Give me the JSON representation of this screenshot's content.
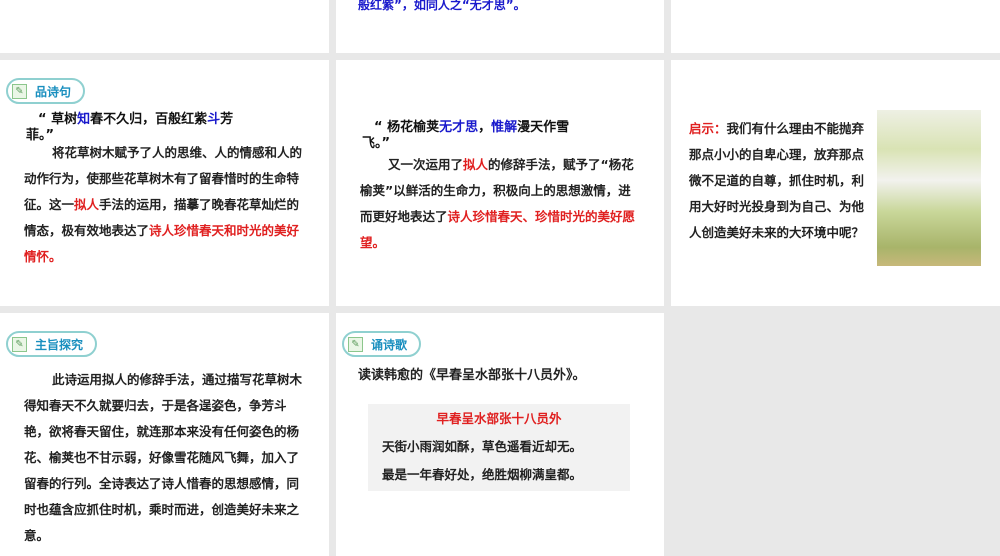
{
  "slides": {
    "s2": {
      "text": "般红紫”，如同人之“无才思”。"
    },
    "s4": {
      "badge": "品诗句",
      "quote_a": "“ 草树",
      "quote_b": "知",
      "quote_c": "春不久归，百般红紫",
      "quote_d": "斗",
      "quote_e": "芳",
      "quote_f": "菲。”",
      "p1": "将花草树木赋予了人的思维、人的情感和人的动作行为，使那些花草树木有了留春惜时的生命特征。这一",
      "p_red1": "拟人",
      "p2": "手法的运用，描摹了晚春花草灿烂的情态，极有效地表达了",
      "p_red2": "诗人珍惜春天和时光的美好情怀。"
    },
    "s5": {
      "quote_a": "“ 杨花榆荚",
      "quote_b": "无才思",
      "quote_c": "，",
      "quote_d": "惟解",
      "quote_e": "漫天作雪",
      "quote_f": "飞。”",
      "p1": "又一次运用了",
      "p_red1": "拟人",
      "p2": "的修辞手法，赋予了“杨花榆荚”以鲜活的生命力，积极向上的思想激情，进而更好地表达了",
      "p_red2": "诗人珍惜春天、珍惜时光的美好愿望。"
    },
    "s6": {
      "label": "启示：",
      "text": "我们有什么理由不能抛弃那点小小的自卑心理，放弃那点微不足道的自尊，抓住时机，利用大好时光投身到为自己、为他人创造美好未来的大环境中呢？"
    },
    "s7": {
      "badge": "主旨探究",
      "text": "此诗运用拟人的修辞手法，通过描写花草树木得知春天不久就要归去，于是各逞姿色，争芳斗艳，欲将春天留住，就连那本来没有任何姿色的杨花、榆荚也不甘示弱，好像雪花随风飞舞，加入了留春的行列。全诗表达了诗人惜春的思想感情，同时也蕴含应抓住时机，乘时而进，创造美好未来之意。"
    },
    "s8": {
      "badge": "诵诗歌",
      "intro": "读读韩愈的《早春呈水部张十八员外》。",
      "poem_title": "早春呈水部张十八员外",
      "line1": "天街小雨润如酥，草色遥看近却无。",
      "line2": "最是一年春好处，绝胜烟柳满皇都。"
    }
  }
}
